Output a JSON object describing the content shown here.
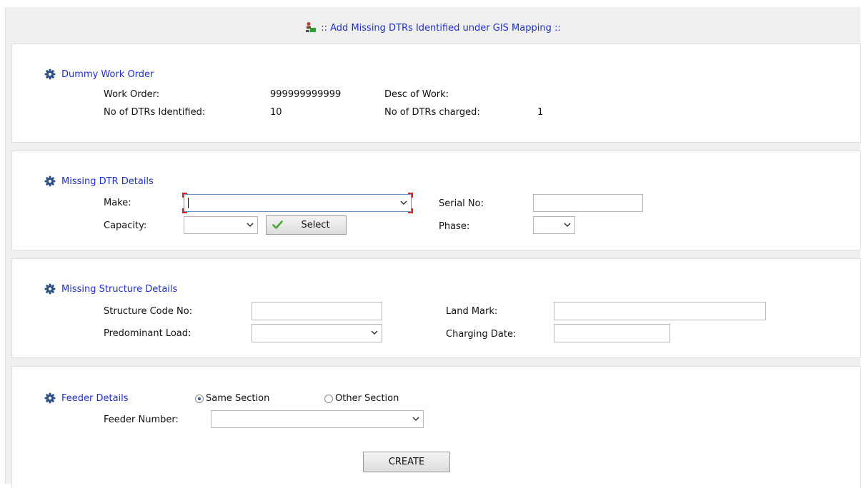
{
  "header": {
    "title": ":: Add Missing DTRs Identified under GIS Mapping ::"
  },
  "dummy_work_order": {
    "title": "Dummy Work Order",
    "work_order_label": "Work Order:",
    "work_order_value": "999999999999",
    "desc_label": "Desc of Work:",
    "desc_value": "",
    "dtrs_identified_label": "No of DTRs Identified:",
    "dtrs_identified_value": "10",
    "dtrs_charged_label": "No of DTRs charged:",
    "dtrs_charged_value": "1"
  },
  "missing_dtr": {
    "title": "Missing DTR Details",
    "make_label": "Make:",
    "make_value": "",
    "serial_label": "Serial No:",
    "serial_value": "",
    "capacity_label": "Capacity:",
    "capacity_value": "",
    "select_button": "Select",
    "phase_label": "Phase:",
    "phase_value": ""
  },
  "missing_structure": {
    "title": "Missing Structure Details",
    "structure_code_label": "Structure Code No:",
    "structure_code_value": "",
    "landmark_label": "Land Mark:",
    "landmark_value": "",
    "predominant_load_label": "Predominant Load:",
    "predominant_load_value": "",
    "charging_date_label": "Charging Date:",
    "charging_date_value": ""
  },
  "feeder": {
    "title": "Feeder Details",
    "same_section_label": "Same Section",
    "other_section_label": "Other Section",
    "selected": "Same Section",
    "feeder_number_label": "Feeder Number:",
    "feeder_number_value": ""
  },
  "actions": {
    "create_button": "CREATE"
  },
  "colors": {
    "accent_blue": "#1f2fd0",
    "gear": "#2b4f86",
    "focus_corner": "#d9232e",
    "panel_bg": "#ffffff",
    "frame_bg": "#efefef"
  }
}
